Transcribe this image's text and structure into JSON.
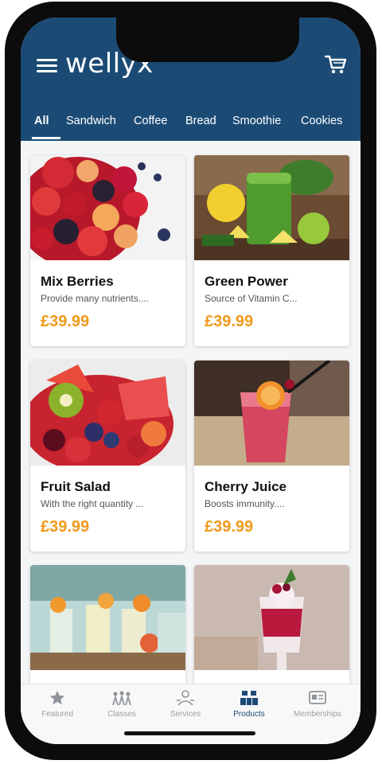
{
  "app": {
    "logo": "wellyx",
    "menu_icon": "hamburger-menu-icon",
    "cart_icon": "shopping-cart-icon",
    "header_color": "#1b4b75",
    "accent_price_color": "#ef9a1b"
  },
  "tabs": [
    {
      "label": "All",
      "active": true
    },
    {
      "label": "Sandwich",
      "active": false
    },
    {
      "label": "Coffee",
      "active": false
    },
    {
      "label": "Bread",
      "active": false
    },
    {
      "label": "Smoothie",
      "active": false
    },
    {
      "label": "Cookies",
      "active": false
    }
  ],
  "products": [
    {
      "name": "Mix Berries",
      "description": "Provide many nutrients....",
      "price": "£39.99"
    },
    {
      "name": "Green Power",
      "description": "Source of Vitamin C...",
      "price": "£39.99"
    },
    {
      "name": "Fruit Salad",
      "description": "With the right quantity ...",
      "price": "£39.99"
    },
    {
      "name": "Cherry Juice",
      "description": "Boosts immunity....",
      "price": "£39.99"
    },
    {
      "name": "",
      "description": "",
      "price": ""
    },
    {
      "name": "",
      "description": "",
      "price": ""
    }
  ],
  "bottom_nav": [
    {
      "label": "Featured",
      "icon": "star-icon",
      "active": false
    },
    {
      "label": "Classes",
      "icon": "people-group-icon",
      "active": false
    },
    {
      "label": "Services",
      "icon": "service-person-icon",
      "active": false
    },
    {
      "label": "Products",
      "icon": "boxes-icon",
      "active": true
    },
    {
      "label": "Memberships",
      "icon": "membership-card-icon",
      "active": false
    }
  ]
}
